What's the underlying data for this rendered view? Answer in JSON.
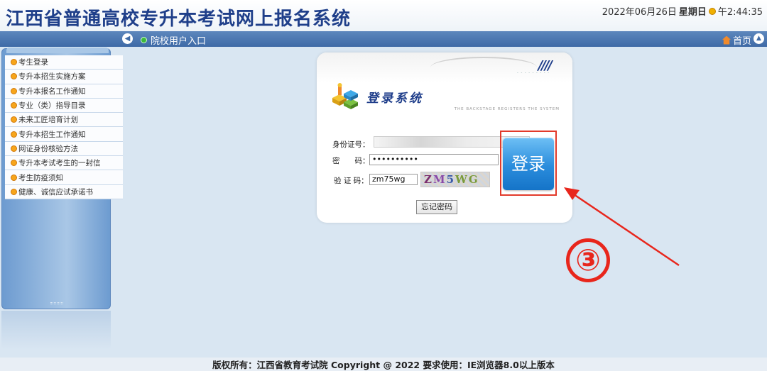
{
  "header": {
    "site_title": "江西省普通高校专升本考试网上报名系统",
    "date": "2022年06月26日",
    "weekday": "星期日",
    "time": "午2:44:35"
  },
  "navbar": {
    "entry_label": "院校用户入口",
    "home_label": "首页"
  },
  "sidebar": {
    "items": [
      {
        "label": "考生登录"
      },
      {
        "label": "专升本招生实施方案"
      },
      {
        "label": "专升本报名工作通知"
      },
      {
        "label": "专业（类）指导目录"
      },
      {
        "label": "未来工匠培育计划"
      },
      {
        "label": "专升本招生工作通知"
      },
      {
        "label": "网证身份核验方法"
      },
      {
        "label": "专升本考试考生的一封信"
      },
      {
        "label": "考生防疫须知"
      },
      {
        "label": "健康、诚信应试承诺书"
      }
    ]
  },
  "login": {
    "heading": "登录系统",
    "subheading": "THE BACKSTAGE REGISTERS THE SYSTEM",
    "deco": "////",
    "deco_sub": "- - - - - - - - -",
    "id_label": "身份证号：",
    "password_label": "密　　码：",
    "password_value": "••••••••••",
    "captcha_label": "验 证 码：",
    "captcha_value": "zm75wg",
    "captcha_image_text": [
      "Z",
      "M",
      "5",
      "WG"
    ],
    "login_button": "登录",
    "forgot_button": "忘记密码"
  },
  "annotation": {
    "step": "③"
  },
  "footer": {
    "text": "版权所有：江西省教育考试院 Copyright @ 2022 要求使用：IE浏览器8.0以上版本"
  },
  "colors": {
    "title": "#1f3f8a",
    "navbar": "#3e6aa6",
    "annotation_red": "#e8261c",
    "login_button": "#2a8cdc"
  }
}
